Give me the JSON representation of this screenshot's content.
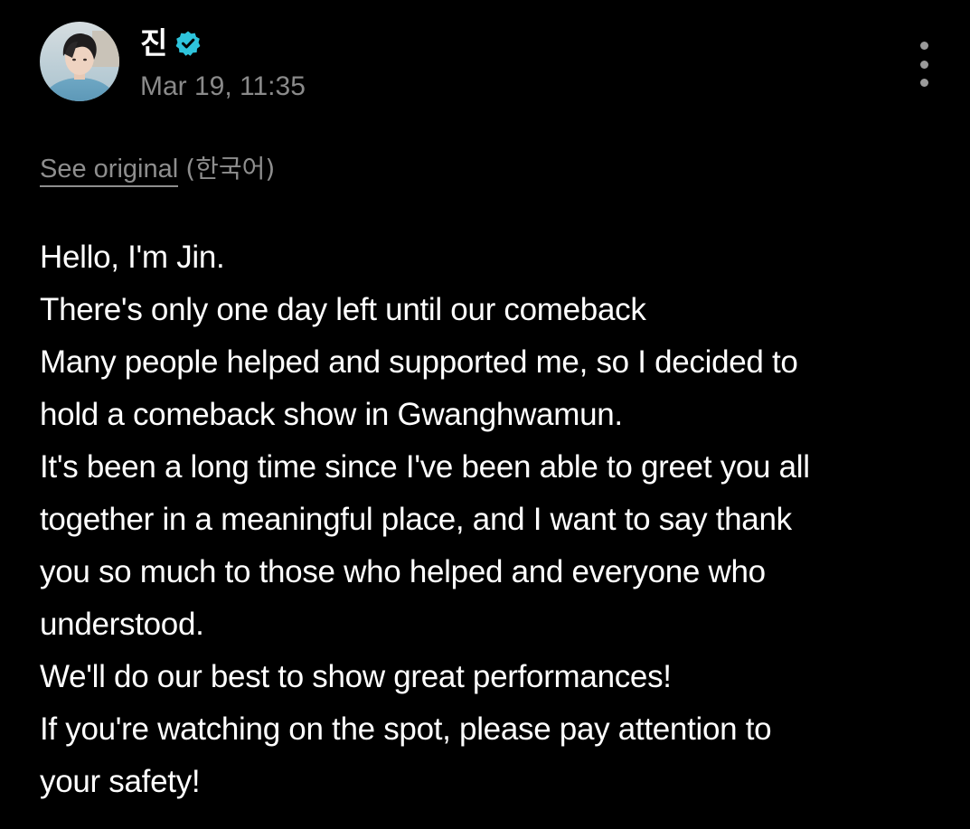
{
  "post": {
    "author_name": "진",
    "verified": true,
    "timestamp": "Mar 19, 11:35",
    "menu_icon": "more-vertical-icon",
    "translation": {
      "see_original": "See original",
      "language": "(한국어)"
    },
    "body_lines": [
      "Hello, I'm Jin.",
      "There's only one day left until our comeback",
      "Many people helped and supported me, so I decided to",
      "hold a comeback show in Gwanghwamun.",
      "It's been a long time since I've been able to greet you all",
      "together in a meaningful place, and I want to say thank",
      "you so much to those who helped and everyone who",
      "understood.",
      "We'll do our best to show great performances!",
      "If you're watching on the spot, please pay attention to",
      "your safety!"
    ]
  },
  "colors": {
    "background": "#000000",
    "text": "#ffffff",
    "muted": "#8a8a8a",
    "verified_badge": "#2ec4dc"
  }
}
